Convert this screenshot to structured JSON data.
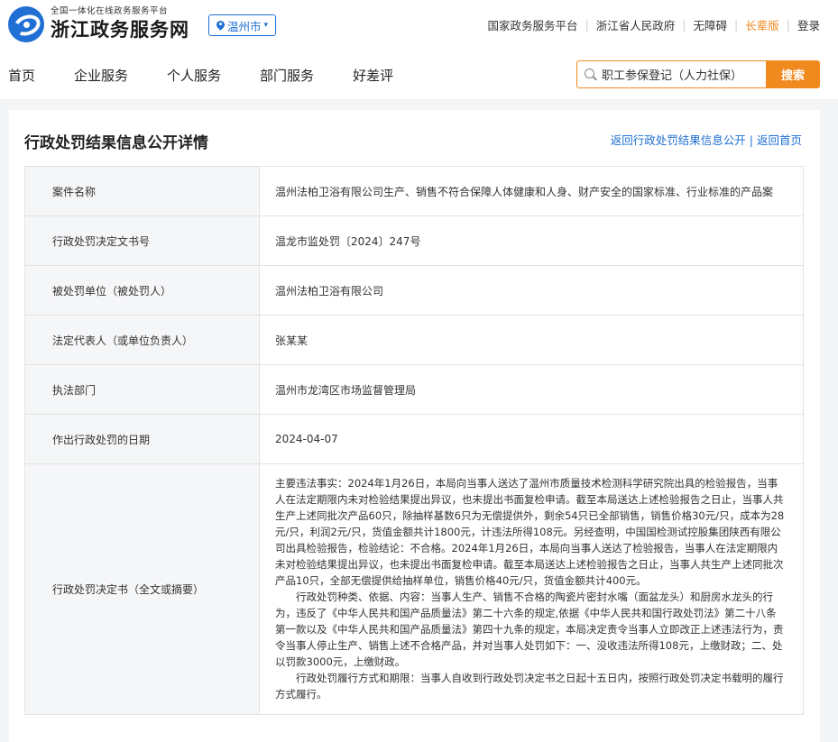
{
  "header": {
    "logo_sub": "全国一体化在线政务服务平台",
    "logo_main": "浙江政务服务网",
    "city": "温州市",
    "links": [
      "国家政务服务平台",
      "浙江省人民政府",
      "无障碍",
      "长辈版",
      "登录"
    ]
  },
  "nav": {
    "items": [
      "首页",
      "企业服务",
      "个人服务",
      "部门服务",
      "好差评"
    ]
  },
  "search": {
    "value": "职工参保登记（人力社保）",
    "button": "搜索"
  },
  "page": {
    "title": "行政处罚结果信息公开详情",
    "crumb_back": "返回行政处罚结果信息公开",
    "crumb_home": "返回首页"
  },
  "rows": [
    {
      "key": "案件名称",
      "value": "温州法柏卫浴有限公司生产、销售不符合保障人体健康和人身、财产安全的国家标准、行业标准的产品案"
    },
    {
      "key": "行政处罚决定文书号",
      "value": "温龙市监处罚〔2024〕247号"
    },
    {
      "key": "被处罚单位（被处罚人）",
      "value": "温州法柏卫浴有限公司"
    },
    {
      "key": "法定代表人（或单位负责人）",
      "value": "张某某"
    },
    {
      "key": "执法部门",
      "value": "温州市龙湾区市场监督管理局"
    },
    {
      "key": "作出行政处罚的日期",
      "value": "2024-04-07"
    }
  ],
  "decision": {
    "key": "行政处罚决定书（全文或摘要）",
    "paragraphs": [
      "主要违法事实：2024年1月26日，本局向当事人送达了温州市质量技术检测科学研究院出具的检验报告，当事人在法定期限内未对检验结果提出异议，也未提出书面复检申请。截至本局送达上述检验报告之日止，当事人共生产上述同批次产品60只，除抽样基数6只为无偿提供外，剩余54只已全部销售，销售价格30元/只，成本为28元/只，利润2元/只，货值金额共计1800元，计违法所得108元。另经查明，中国国检测试控股集团陕西有限公司出具检验报告，检验结论：不合格。2024年1月26日，本局向当事人送达了检验报告，当事人在法定期限内未对检验结果提出异议，也未提出书面复检申请。截至本局送达上述检验报告之日止，当事人共生产上述同批次产品10只，全部无偿提供给抽样单位，销售价格40元/只，货值金额共计400元。",
      "行政处罚种类、依据、内容：当事人生产、销售不合格的陶瓷片密封水嘴（面盆龙头）和厨房水龙头的行为，违反了《中华人民共和国产品质量法》第二十六条的规定,依据《中华人民共和国行政处罚法》第二十八条第一款以及《中华人民共和国产品质量法》第四十九条的规定，本局决定责令当事人立即改正上述违法行为，责令当事人停止生产、销售上述不合格产品，并对当事人处罚如下：一、没收违法所得108元，上缴财政；二、处以罚款3000元，上缴财政。",
      "行政处罚履行方式和期限：当事人自收到行政处罚决定书之日起十五日内，按照行政处罚决定书载明的履行方式履行。"
    ]
  },
  "colors": {
    "brand_blue": "#1f6fd4",
    "accent_orange": "#f08a1e"
  }
}
